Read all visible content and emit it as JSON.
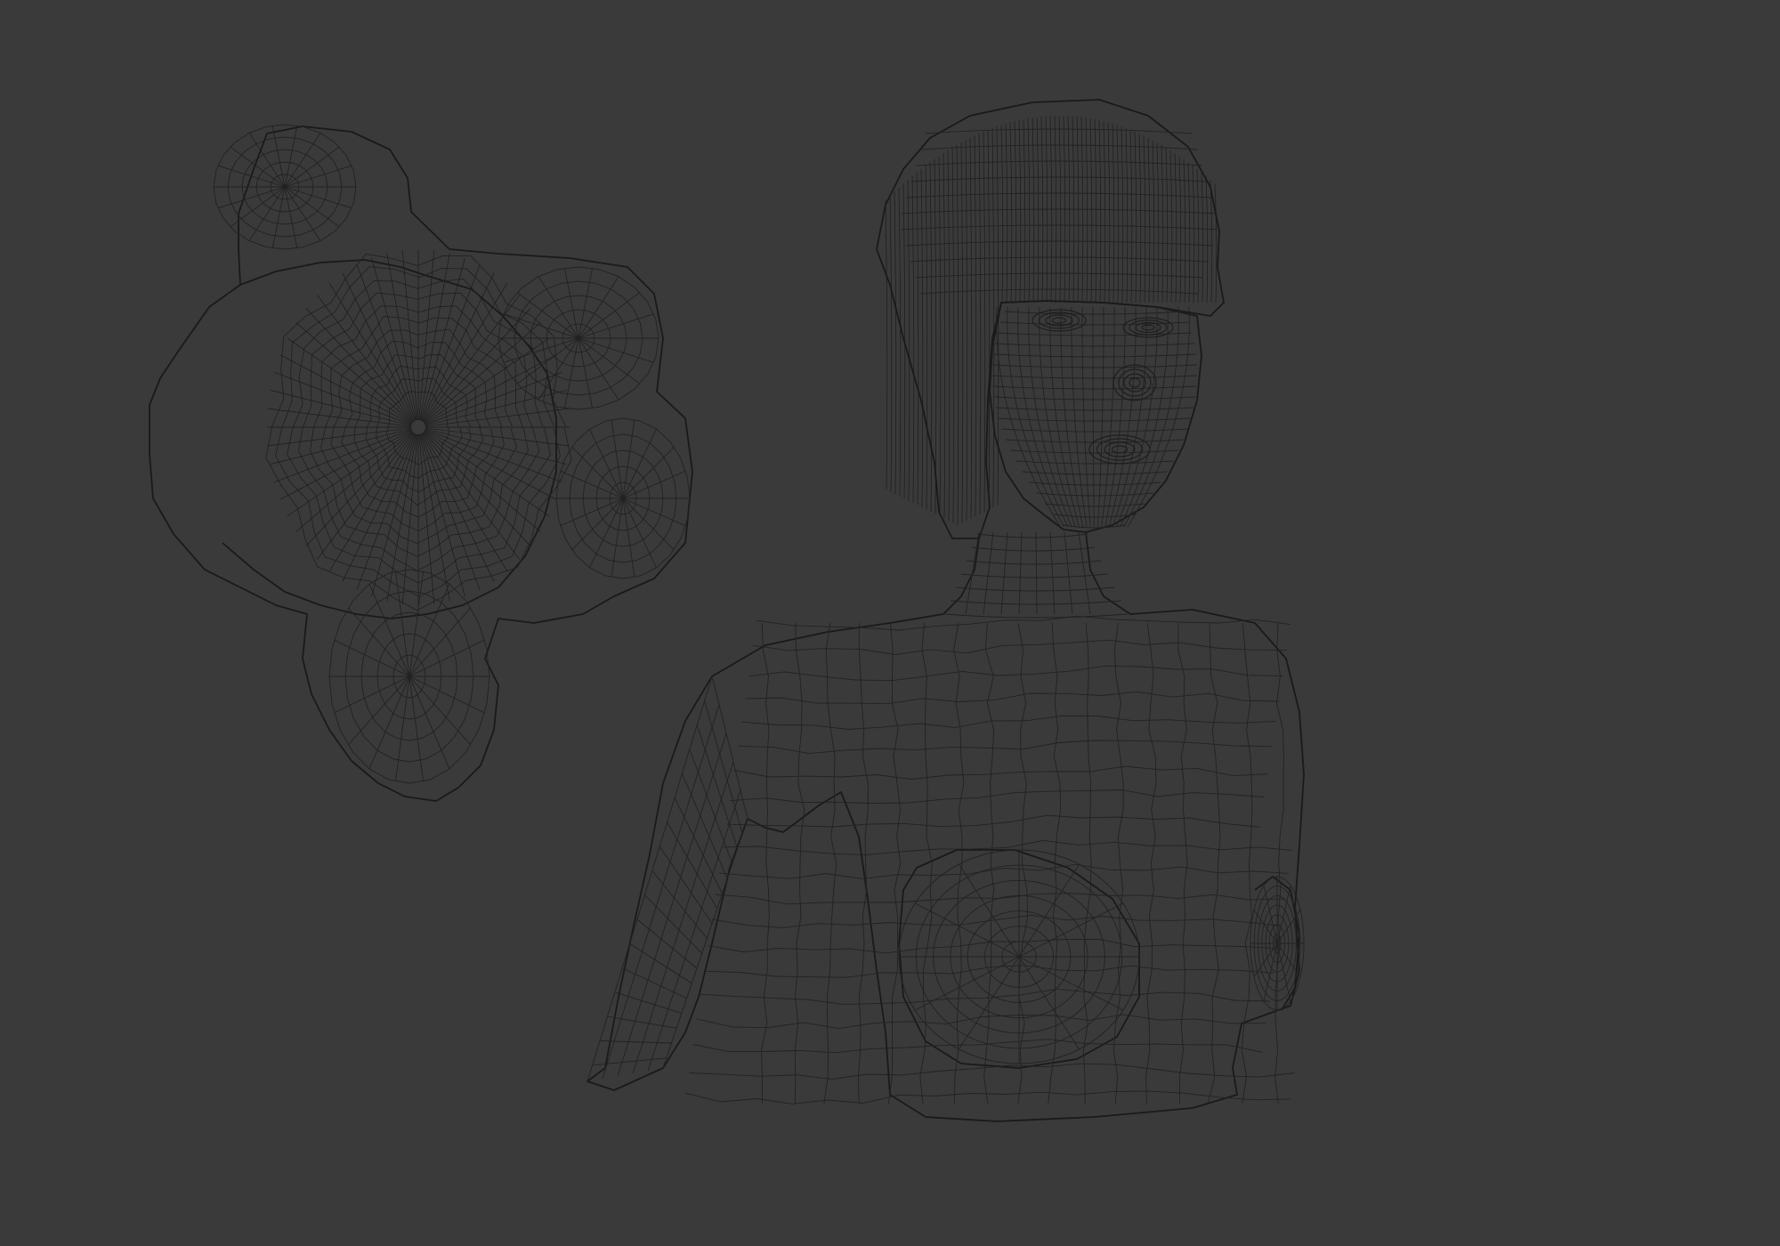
{
  "viewport": {
    "background_color": "#3a3a3a",
    "wire_color": "#1e1e1e",
    "objects": [
      {
        "name": "hair-bun-mesh"
      },
      {
        "name": "female-bust-mesh"
      }
    ]
  }
}
